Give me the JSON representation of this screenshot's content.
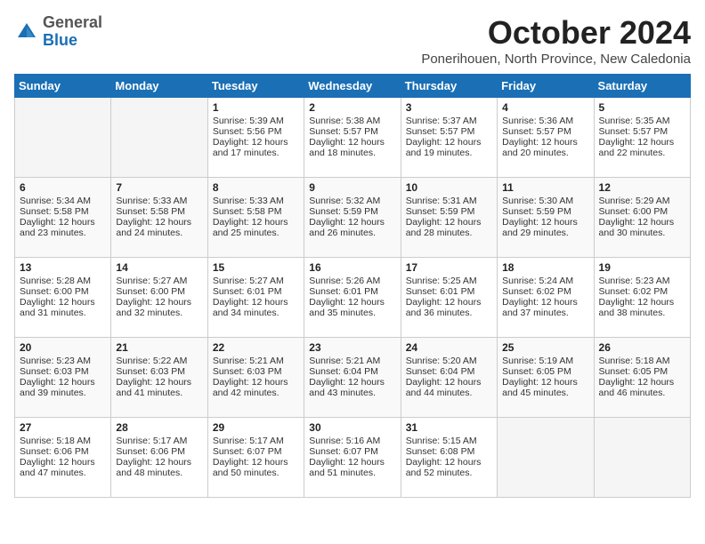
{
  "header": {
    "logo_general": "General",
    "logo_blue": "Blue",
    "month_title": "October 2024",
    "location": "Ponerihouen, North Province, New Caledonia"
  },
  "days_of_week": [
    "Sunday",
    "Monday",
    "Tuesday",
    "Wednesday",
    "Thursday",
    "Friday",
    "Saturday"
  ],
  "weeks": [
    [
      {
        "day": "",
        "sunrise": "",
        "sunset": "",
        "daylight": ""
      },
      {
        "day": "",
        "sunrise": "",
        "sunset": "",
        "daylight": ""
      },
      {
        "day": "1",
        "sunrise": "Sunrise: 5:39 AM",
        "sunset": "Sunset: 5:56 PM",
        "daylight": "Daylight: 12 hours and 17 minutes."
      },
      {
        "day": "2",
        "sunrise": "Sunrise: 5:38 AM",
        "sunset": "Sunset: 5:57 PM",
        "daylight": "Daylight: 12 hours and 18 minutes."
      },
      {
        "day": "3",
        "sunrise": "Sunrise: 5:37 AM",
        "sunset": "Sunset: 5:57 PM",
        "daylight": "Daylight: 12 hours and 19 minutes."
      },
      {
        "day": "4",
        "sunrise": "Sunrise: 5:36 AM",
        "sunset": "Sunset: 5:57 PM",
        "daylight": "Daylight: 12 hours and 20 minutes."
      },
      {
        "day": "5",
        "sunrise": "Sunrise: 5:35 AM",
        "sunset": "Sunset: 5:57 PM",
        "daylight": "Daylight: 12 hours and 22 minutes."
      }
    ],
    [
      {
        "day": "6",
        "sunrise": "Sunrise: 5:34 AM",
        "sunset": "Sunset: 5:58 PM",
        "daylight": "Daylight: 12 hours and 23 minutes."
      },
      {
        "day": "7",
        "sunrise": "Sunrise: 5:33 AM",
        "sunset": "Sunset: 5:58 PM",
        "daylight": "Daylight: 12 hours and 24 minutes."
      },
      {
        "day": "8",
        "sunrise": "Sunrise: 5:33 AM",
        "sunset": "Sunset: 5:58 PM",
        "daylight": "Daylight: 12 hours and 25 minutes."
      },
      {
        "day": "9",
        "sunrise": "Sunrise: 5:32 AM",
        "sunset": "Sunset: 5:59 PM",
        "daylight": "Daylight: 12 hours and 26 minutes."
      },
      {
        "day": "10",
        "sunrise": "Sunrise: 5:31 AM",
        "sunset": "Sunset: 5:59 PM",
        "daylight": "Daylight: 12 hours and 28 minutes."
      },
      {
        "day": "11",
        "sunrise": "Sunrise: 5:30 AM",
        "sunset": "Sunset: 5:59 PM",
        "daylight": "Daylight: 12 hours and 29 minutes."
      },
      {
        "day": "12",
        "sunrise": "Sunrise: 5:29 AM",
        "sunset": "Sunset: 6:00 PM",
        "daylight": "Daylight: 12 hours and 30 minutes."
      }
    ],
    [
      {
        "day": "13",
        "sunrise": "Sunrise: 5:28 AM",
        "sunset": "Sunset: 6:00 PM",
        "daylight": "Daylight: 12 hours and 31 minutes."
      },
      {
        "day": "14",
        "sunrise": "Sunrise: 5:27 AM",
        "sunset": "Sunset: 6:00 PM",
        "daylight": "Daylight: 12 hours and 32 minutes."
      },
      {
        "day": "15",
        "sunrise": "Sunrise: 5:27 AM",
        "sunset": "Sunset: 6:01 PM",
        "daylight": "Daylight: 12 hours and 34 minutes."
      },
      {
        "day": "16",
        "sunrise": "Sunrise: 5:26 AM",
        "sunset": "Sunset: 6:01 PM",
        "daylight": "Daylight: 12 hours and 35 minutes."
      },
      {
        "day": "17",
        "sunrise": "Sunrise: 5:25 AM",
        "sunset": "Sunset: 6:01 PM",
        "daylight": "Daylight: 12 hours and 36 minutes."
      },
      {
        "day": "18",
        "sunrise": "Sunrise: 5:24 AM",
        "sunset": "Sunset: 6:02 PM",
        "daylight": "Daylight: 12 hours and 37 minutes."
      },
      {
        "day": "19",
        "sunrise": "Sunrise: 5:23 AM",
        "sunset": "Sunset: 6:02 PM",
        "daylight": "Daylight: 12 hours and 38 minutes."
      }
    ],
    [
      {
        "day": "20",
        "sunrise": "Sunrise: 5:23 AM",
        "sunset": "Sunset: 6:03 PM",
        "daylight": "Daylight: 12 hours and 39 minutes."
      },
      {
        "day": "21",
        "sunrise": "Sunrise: 5:22 AM",
        "sunset": "Sunset: 6:03 PM",
        "daylight": "Daylight: 12 hours and 41 minutes."
      },
      {
        "day": "22",
        "sunrise": "Sunrise: 5:21 AM",
        "sunset": "Sunset: 6:03 PM",
        "daylight": "Daylight: 12 hours and 42 minutes."
      },
      {
        "day": "23",
        "sunrise": "Sunrise: 5:21 AM",
        "sunset": "Sunset: 6:04 PM",
        "daylight": "Daylight: 12 hours and 43 minutes."
      },
      {
        "day": "24",
        "sunrise": "Sunrise: 5:20 AM",
        "sunset": "Sunset: 6:04 PM",
        "daylight": "Daylight: 12 hours and 44 minutes."
      },
      {
        "day": "25",
        "sunrise": "Sunrise: 5:19 AM",
        "sunset": "Sunset: 6:05 PM",
        "daylight": "Daylight: 12 hours and 45 minutes."
      },
      {
        "day": "26",
        "sunrise": "Sunrise: 5:18 AM",
        "sunset": "Sunset: 6:05 PM",
        "daylight": "Daylight: 12 hours and 46 minutes."
      }
    ],
    [
      {
        "day": "27",
        "sunrise": "Sunrise: 5:18 AM",
        "sunset": "Sunset: 6:06 PM",
        "daylight": "Daylight: 12 hours and 47 minutes."
      },
      {
        "day": "28",
        "sunrise": "Sunrise: 5:17 AM",
        "sunset": "Sunset: 6:06 PM",
        "daylight": "Daylight: 12 hours and 48 minutes."
      },
      {
        "day": "29",
        "sunrise": "Sunrise: 5:17 AM",
        "sunset": "Sunset: 6:07 PM",
        "daylight": "Daylight: 12 hours and 50 minutes."
      },
      {
        "day": "30",
        "sunrise": "Sunrise: 5:16 AM",
        "sunset": "Sunset: 6:07 PM",
        "daylight": "Daylight: 12 hours and 51 minutes."
      },
      {
        "day": "31",
        "sunrise": "Sunrise: 5:15 AM",
        "sunset": "Sunset: 6:08 PM",
        "daylight": "Daylight: 12 hours and 52 minutes."
      },
      {
        "day": "",
        "sunrise": "",
        "sunset": "",
        "daylight": ""
      },
      {
        "day": "",
        "sunrise": "",
        "sunset": "",
        "daylight": ""
      }
    ]
  ]
}
